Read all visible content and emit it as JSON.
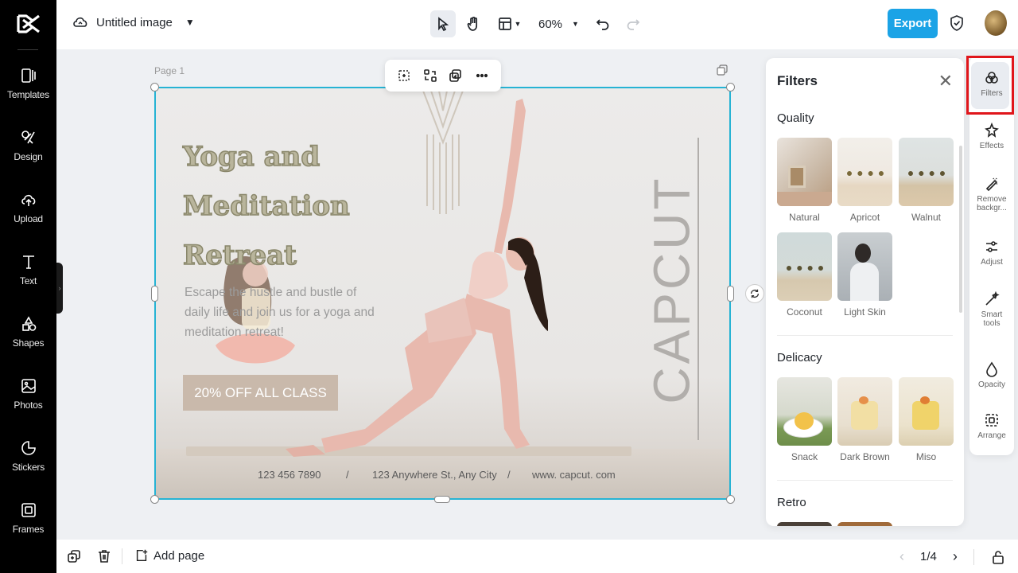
{
  "sidebar": {
    "items": [
      {
        "label": "Templates",
        "icon": "templates-icon"
      },
      {
        "label": "Design",
        "icon": "design-icon"
      },
      {
        "label": "Upload",
        "icon": "upload-icon"
      },
      {
        "label": "Text",
        "icon": "text-icon"
      },
      {
        "label": "Shapes",
        "icon": "shapes-icon"
      },
      {
        "label": "Photos",
        "icon": "photos-icon"
      },
      {
        "label": "Stickers",
        "icon": "stickers-icon"
      },
      {
        "label": "Frames",
        "icon": "frames-icon"
      }
    ]
  },
  "topbar": {
    "title": "Untitled image",
    "zoom": "60%",
    "export_label": "Export"
  },
  "canvas": {
    "page_label": "Page 1",
    "heading_lines": [
      "Yoga and",
      "Meditation",
      "Retreat"
    ],
    "body": "Escape the hustle and bustle of daily life and join us for a yoga and meditation retreat!",
    "cta": "20% OFF ALL CLASS",
    "phone": "123  456  7890",
    "address": "123 Anywhere St., Any City",
    "website": "www. capcut. com",
    "separator": "/",
    "brand": "CAPCUT"
  },
  "filters": {
    "title": "Filters",
    "sections": [
      {
        "name": "Quality",
        "items": [
          "Natural",
          "Apricot",
          "Walnut",
          "Coconut",
          "Light Skin"
        ]
      },
      {
        "name": "Delicacy",
        "items": [
          "Snack",
          "Dark Brown",
          "Miso"
        ]
      },
      {
        "name": "Retro",
        "items": []
      }
    ]
  },
  "rail": {
    "items": [
      {
        "label": "Filters",
        "icon": "filters-icon"
      },
      {
        "label": "Effects",
        "icon": "effects-icon"
      },
      {
        "label": "Remove backgr...",
        "icon": "remove-background-icon"
      },
      {
        "label": "Adjust",
        "icon": "adjust-icon"
      },
      {
        "label": "Smart tools",
        "icon": "smart-tools-icon"
      },
      {
        "label": "Opacity",
        "icon": "opacity-icon"
      },
      {
        "label": "Arrange",
        "icon": "arrange-icon"
      }
    ]
  },
  "bottombar": {
    "add_page": "Add page",
    "page_indicator": "1/4"
  },
  "colors": {
    "sidebar_bg": "#000000",
    "accent": "#1ba3e6",
    "selection": "#26b3d4",
    "highlight_box": "#e0161b"
  }
}
